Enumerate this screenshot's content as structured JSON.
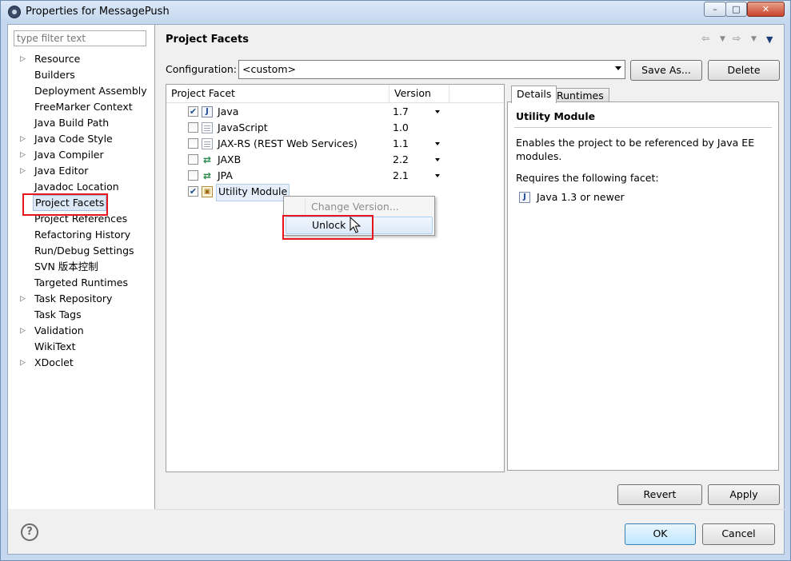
{
  "window": {
    "title": "Properties for MessagePush",
    "minimize_glyph": "–",
    "maximize_glyph": "□",
    "close_glyph": "✕"
  },
  "sidebar": {
    "filter_placeholder": "type filter text",
    "items": [
      {
        "label": "Resource",
        "expandable": true
      },
      {
        "label": "Builders",
        "expandable": false
      },
      {
        "label": "Deployment Assembly",
        "expandable": false
      },
      {
        "label": "FreeMarker Context",
        "expandable": false
      },
      {
        "label": "Java Build Path",
        "expandable": false
      },
      {
        "label": "Java Code Style",
        "expandable": true
      },
      {
        "label": "Java Compiler",
        "expandable": true
      },
      {
        "label": "Java Editor",
        "expandable": true
      },
      {
        "label": "Javadoc Location",
        "expandable": false
      },
      {
        "label": "Project Facets",
        "expandable": false,
        "selected": true
      },
      {
        "label": "Project References",
        "expandable": false
      },
      {
        "label": "Refactoring History",
        "expandable": false
      },
      {
        "label": "Run/Debug Settings",
        "expandable": false
      },
      {
        "label": "SVN 版本控制",
        "expandable": false
      },
      {
        "label": "Targeted Runtimes",
        "expandable": false
      },
      {
        "label": "Task Repository",
        "expandable": true
      },
      {
        "label": "Task Tags",
        "expandable": false
      },
      {
        "label": "Validation",
        "expandable": true
      },
      {
        "label": "WikiText",
        "expandable": false
      },
      {
        "label": "XDoclet",
        "expandable": true
      }
    ]
  },
  "page": {
    "title": "Project Facets",
    "configuration_label": "Configuration:",
    "configuration_value": "<custom>",
    "save_as_label": "Save As...",
    "delete_label": "Delete"
  },
  "facets_table": {
    "col_facet": "Project Facet",
    "col_version": "Version",
    "rows": [
      {
        "name": "Java",
        "version": "1.7",
        "checked": true,
        "icon": "java-icon",
        "has_dropdown": true
      },
      {
        "name": "JavaScript",
        "version": "1.0",
        "checked": false,
        "icon": "document-icon",
        "has_dropdown": false
      },
      {
        "name": "JAX-RS (REST Web Services)",
        "version": "1.1",
        "checked": false,
        "icon": "document-icon",
        "has_dropdown": true
      },
      {
        "name": "JAXB",
        "version": "2.2",
        "checked": false,
        "icon": "xml-arrows-icon",
        "has_dropdown": true
      },
      {
        "name": "JPA",
        "version": "2.1",
        "checked": false,
        "icon": "xml-arrows-icon",
        "has_dropdown": true
      },
      {
        "name": "Utility Module",
        "version": "",
        "checked": true,
        "icon": "locked-module-icon",
        "has_dropdown": false,
        "selected": true
      }
    ]
  },
  "context_menu": {
    "items": [
      {
        "label": "Change Version...",
        "enabled": false
      },
      {
        "label": "Unlock",
        "enabled": true,
        "hovered": true
      }
    ]
  },
  "details": {
    "tabs": [
      "Details",
      "Runtimes"
    ],
    "active_tab": "Details",
    "title": "Utility Module",
    "description": "Enables the project to be referenced by Java EE modules.",
    "requires_label": "Requires the following facet:",
    "requirement": "Java 1.3 or newer"
  },
  "buttons": {
    "revert": "Revert",
    "apply": "Apply",
    "ok": "OK",
    "cancel": "Cancel",
    "help": "?"
  },
  "colors": {
    "highlight": "#e8161c",
    "selection": "#dde8f6",
    "window_frame": "#c5d8ef"
  }
}
